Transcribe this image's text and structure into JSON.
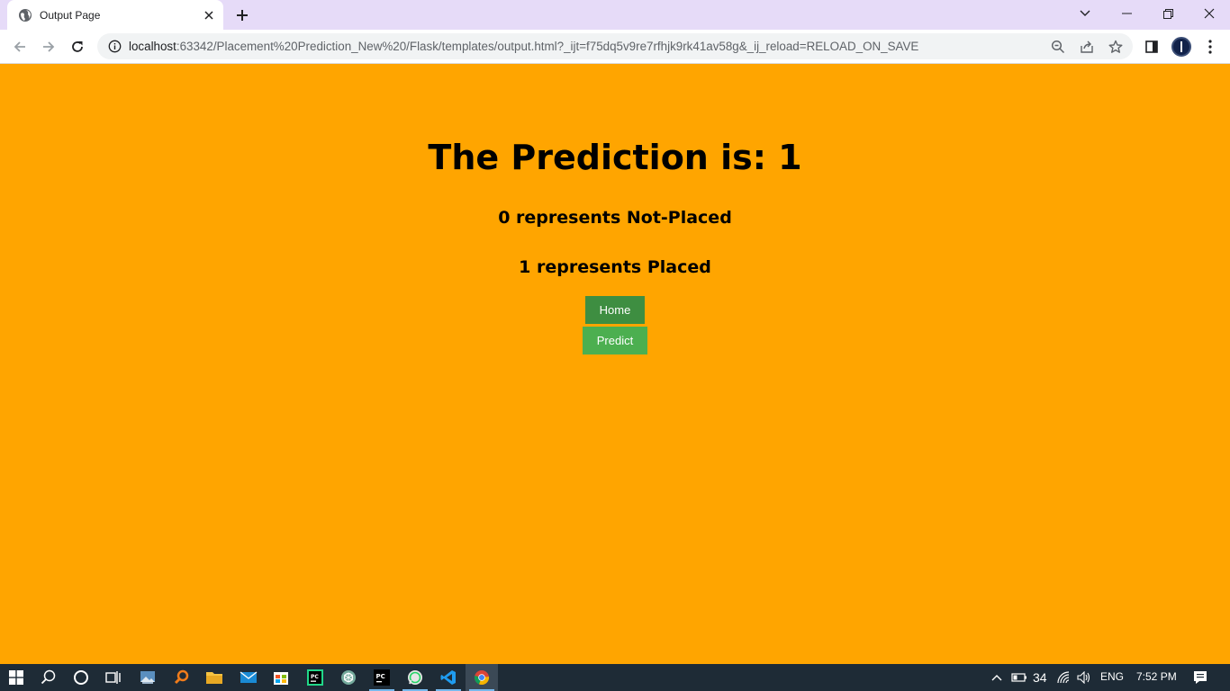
{
  "browser": {
    "tab": {
      "title": "Output Page",
      "favicon": "globe-icon"
    },
    "address_bar": {
      "host": "localhost",
      "rest": ":63342/Placement%20Prediction_New%20/Flask/templates/output.html?_ijt=f75dq5v9re7rfhjk9rk41av58g&_ij_reload=RELOAD_ON_SAVE"
    },
    "icons": [
      "back-arrow-icon",
      "forward-arrow-icon",
      "reload-icon",
      "info-icon",
      "zoom-icon",
      "share-icon",
      "star-icon",
      "side-panel-icon",
      "profile-avatar",
      "more-menu-icon"
    ]
  },
  "page": {
    "background": "#ffa500",
    "title": "The Prediction is: 1",
    "legend_0": "0 represents Not-Placed",
    "legend_1": "1 represents Placed",
    "home_label": "Home",
    "predict_label": "Predict",
    "home_color": "#3e8e41",
    "predict_color": "#4caf50"
  },
  "taskbar": {
    "apps": [
      "windows-start-icon",
      "search-icon",
      "cortana-icon",
      "task-view-icon",
      "photos-icon",
      "search-app-icon",
      "file-explorer-icon",
      "mail-icon",
      "store-icon",
      "pycharm-ce-icon",
      "chatgpt-icon",
      "pycharm-icon",
      "whatsapp-icon",
      "vscode-icon",
      "chrome-icon"
    ],
    "tray": {
      "battery": "34",
      "language": "ENG",
      "time": "7:52 PM"
    }
  }
}
